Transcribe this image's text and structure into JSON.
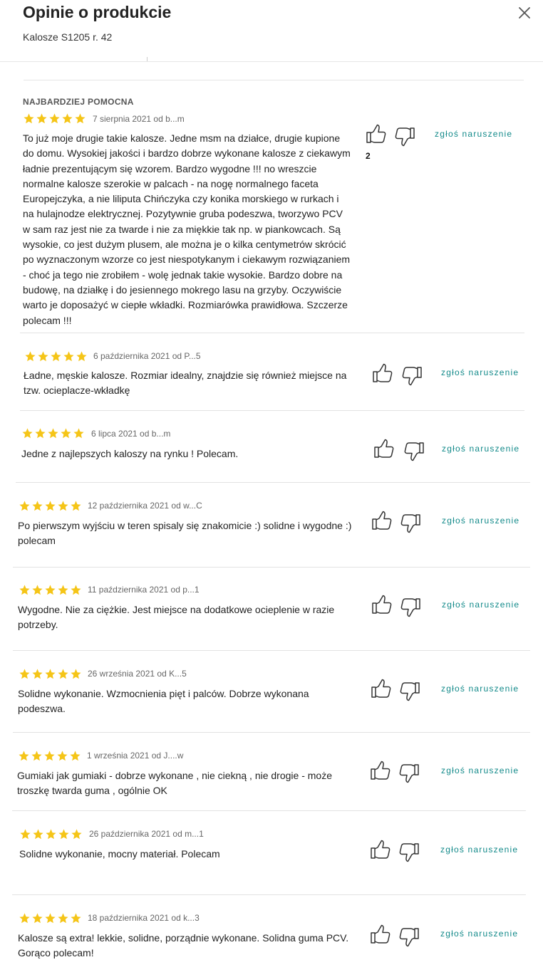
{
  "header": {
    "title": "Opinie o produkcie",
    "subtitle": "Kalosze S1205 r. 42"
  },
  "best_label": "NAJBARDZIEJ POMOCNA",
  "report_label": "zgłoś naruszenie",
  "star_color": "#f5c518",
  "accent_color": "#138a8a",
  "reviews": [
    {
      "rating": 5,
      "meta": "7 sierpnia 2021 od b...m",
      "text": "To już moje drugie takie kalosze. Jedne msm na działce, drugie kupione do domu. Wysokiej jakości i bardzo dobrze wykonane kalosze z ciekawym ładnie prezentującym się wzorem. Bardzo wygodne !!! no wreszcie normalne kalosze szerokie w palcach - na nogę normalnego faceta Europejczyka, a nie liliputa Chińczyka czy konika morskiego w rurkach i na hulajnodze elektrycznej. Pozytywnie gruba podeszwa, tworzywo PCV w sam raz jest nie za twarde i nie za miękkie tak np. w piankowcach. Są wysokie, co jest dużym plusem, ale można je o kilka centymetrów skrócić po wyznaczonym wzorze co jest niespotykanym i ciekawym rozwiązaniem - choć ja tego nie zrobiłem - wolę jednak takie wysokie. Bardzo dobre na budowę, na działkę i do jesiennego mokrego lasu na grzyby. Oczywiście warto je doposażyć w ciepłe wkładki. Rozmiarówka prawidłowa. Szczerze polecam !!!",
      "likes": "2"
    },
    {
      "rating": 5,
      "meta": "6 października 2021 od P...5",
      "text": "Ładne, męskie kalosze. Rozmiar idealny, znajdzie się również miejsce na tzw. ocieplacze-wkładkę"
    },
    {
      "rating": 5,
      "meta": "6 lipca 2021 od b...m",
      "text": "Jedne z najlepszych kaloszy na rynku ! Polecam."
    },
    {
      "rating": 5,
      "meta": "12 października 2021 od w...C",
      "text": "Po pierwszym wyjściu w teren spisaly się znakomicie :) solidne i wygodne :) polecam"
    },
    {
      "rating": 5,
      "meta": "11 października 2021 od p...1",
      "text": "Wygodne. Nie za ciężkie. Jest miejsce na dodatkowe ocieplenie w razie potrzeby."
    },
    {
      "rating": 5,
      "meta": "26 września 2021 od K...5",
      "text": "Solidne wykonanie. Wzmocnienia pięt i palców. Dobrze wykonana podeszwa."
    },
    {
      "rating": 5,
      "meta": "1 września 2021 od J....w",
      "text": "Gumiaki jak gumiaki - dobrze wykonane , nie ciekną , nie drogie - może troszkę twarda guma , ogólnie OK"
    },
    {
      "rating": 5,
      "meta": "26 października 2021 od m...1",
      "text": "Solidne wykonanie, mocny materiał. Polecam"
    },
    {
      "rating": 5,
      "meta": "18 października 2021 od k...3",
      "text": "Kalosze są extra! lekkie, solidne, porządnie wykonane. Solidna guma PCV. Gorąco polecam!"
    }
  ]
}
